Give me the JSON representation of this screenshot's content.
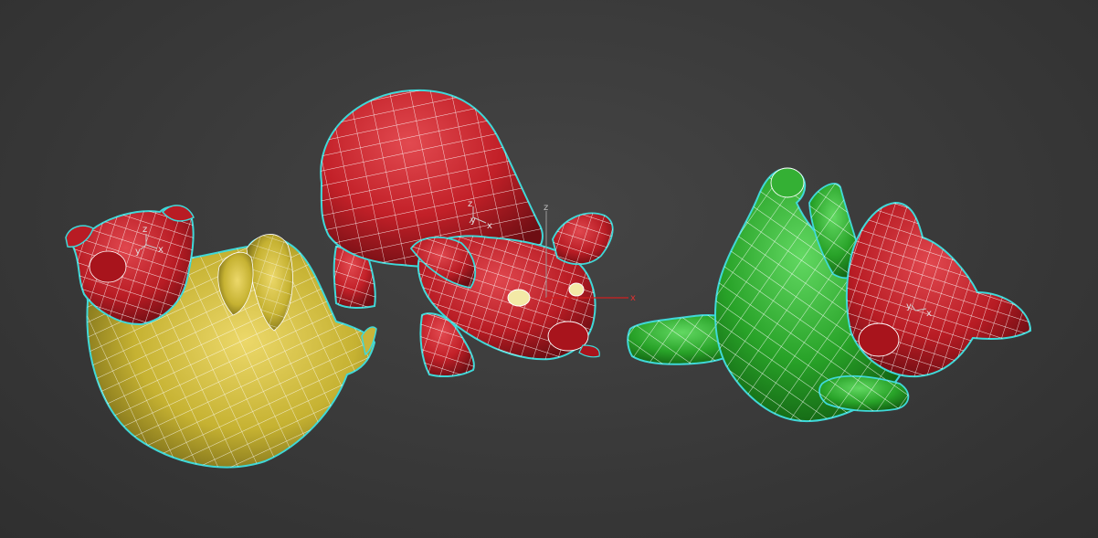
{
  "viewport": {
    "name": "3d-perspective-viewport",
    "background": "#3b3b3b"
  },
  "colors": {
    "pig_red": "#c8262e",
    "pig_red_dark": "#7a1116",
    "pig_yellow": "#c9b53a",
    "pig_yellow_dark": "#6f6214",
    "pig_green": "#2ea82e",
    "pig_green_dark": "#146614",
    "selection_outline": "#3fd8d8",
    "wireframe": "#ffffff",
    "eye": "#f3e9a6",
    "axis_x": "#d02020",
    "axis_gizmo": "#c8c8c8"
  },
  "objects": [
    {
      "id": "pig-yellow",
      "body_color": "yellow",
      "head_color": "red",
      "pose": "lying on back",
      "selected": true
    },
    {
      "id": "pig-red",
      "body_color": "red",
      "head_color": "red",
      "pose": "bowing",
      "selected": true
    },
    {
      "id": "pig-green",
      "body_color": "green",
      "head_color": "red",
      "pose": "rolling",
      "selected": true
    }
  ],
  "gizmos": {
    "left_pivot": {
      "axes": [
        "z",
        "y",
        "x"
      ]
    },
    "center_pivot": {
      "axes": [
        "z",
        "y",
        "x"
      ]
    },
    "center_transform": {
      "axes": [
        "z",
        "x"
      ]
    },
    "right_pivot": {
      "axes": [
        "y",
        "x"
      ]
    }
  }
}
